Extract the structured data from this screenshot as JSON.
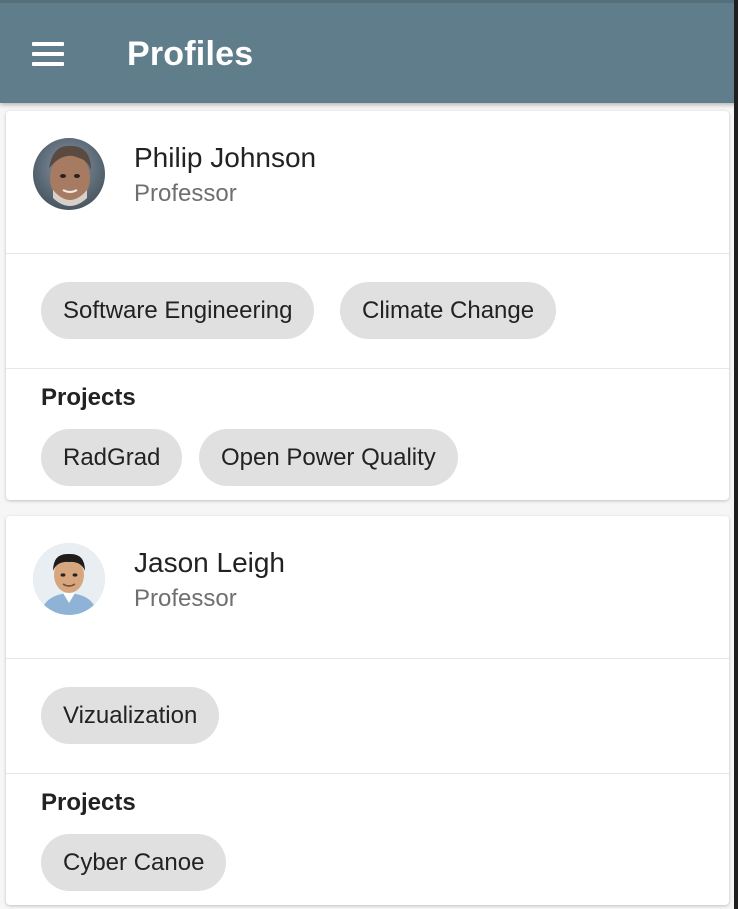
{
  "app_bar": {
    "title": "Profiles",
    "menu_icon": "menu-icon"
  },
  "profiles": [
    {
      "name": "Philip Johnson",
      "role": "Professor",
      "interests": [
        "Software Engineering",
        "Climate Change"
      ],
      "projects_heading": "Projects",
      "projects": [
        "RadGrad",
        "Open Power Quality"
      ]
    },
    {
      "name": "Jason Leigh",
      "role": "Professor",
      "interests": [
        "Vizualization"
      ],
      "projects_heading": "Projects",
      "projects": [
        "Cyber Canoe"
      ]
    }
  ],
  "colors": {
    "app_bar": "#607d8b",
    "chip": "#e0e0e0",
    "card": "#ffffff",
    "background": "#f6f6f6"
  }
}
